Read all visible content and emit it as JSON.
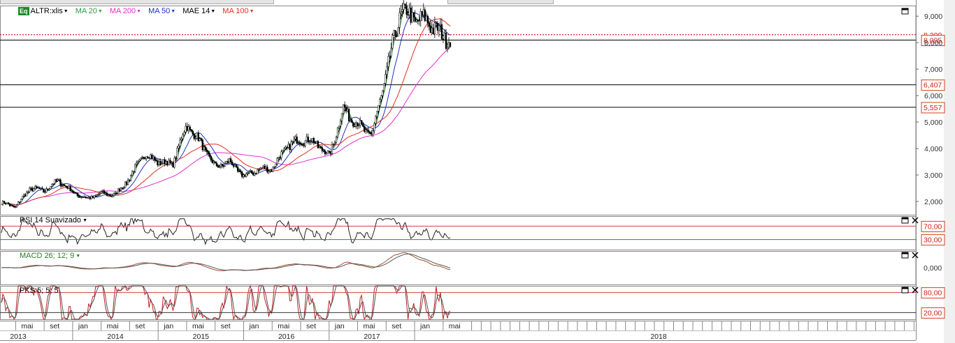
{
  "legend": {
    "eq_badge": "Eq",
    "instrument": "ALTR:xlis",
    "items": [
      {
        "label": "MA 20",
        "color": "#2aa04a"
      },
      {
        "label": "MA 200",
        "color": "#e030d0"
      },
      {
        "label": "MA 50",
        "color": "#2030c0"
      },
      {
        "label": "MAE 14",
        "color": "#000000"
      },
      {
        "label": "MA 100",
        "color": "#e03020"
      }
    ]
  },
  "panels": {
    "rsi": {
      "label": "RSI 14 Suavizado",
      "ref_levels": [
        "70,00",
        "30,00"
      ]
    },
    "macd": {
      "label": "MACD 26; 12; 9",
      "ref_levels": [
        "0,000"
      ]
    },
    "pks": {
      "label": "PKS 5; 5; 5",
      "ref_levels": [
        "80,00",
        "20,00"
      ]
    }
  },
  "chart_data": {
    "type": "candlestick",
    "title": "",
    "price_axis_ticks": [
      "2,000",
      "3,000",
      "4,000",
      "5,000",
      "6,000",
      "7,000",
      "8,000",
      "9,000"
    ],
    "price_ylim": [
      1.5,
      9.4
    ],
    "horizontal_levels": [
      {
        "value": 8.3,
        "label": "8,300",
        "style": "dotted",
        "color": "#cc2020"
      },
      {
        "value": 8.095,
        "label": "8,095"
      },
      {
        "value": 6.407,
        "label": "6,407"
      },
      {
        "value": 5.557,
        "label": "5,557"
      }
    ],
    "x_months": [
      "mai",
      "set",
      "jan",
      "mai",
      "set",
      "jan",
      "mai",
      "set",
      "jan",
      "mai",
      "set",
      "jan",
      "mai",
      "set",
      "jan",
      "mai"
    ],
    "x_years": [
      "2013",
      "2014",
      "2015",
      "2016",
      "2017",
      "2018"
    ],
    "x_start": "2013-03",
    "x_end": "2018-06",
    "price_series": {
      "name": "ALTR:xlis",
      "dates": [
        "2013-03",
        "2013-05",
        "2013-07",
        "2013-09",
        "2013-11",
        "2014-01",
        "2014-03",
        "2014-05",
        "2014-07",
        "2014-09",
        "2014-11",
        "2015-01",
        "2015-03",
        "2015-05",
        "2015-07",
        "2015-09",
        "2015-11",
        "2016-01",
        "2016-03",
        "2016-05",
        "2016-07",
        "2016-09",
        "2016-11",
        "2017-01",
        "2017-03",
        "2017-05",
        "2017-07",
        "2017-09",
        "2017-11",
        "2018-01",
        "2018-03",
        "2018-05"
      ],
      "close": [
        1.95,
        1.8,
        2.5,
        2.4,
        2.8,
        2.35,
        2.1,
        2.3,
        2.25,
        2.9,
        3.8,
        3.5,
        3.4,
        4.9,
        4.2,
        3.3,
        3.5,
        2.95,
        3.2,
        3.25,
        4.05,
        4.35,
        4.25,
        3.7,
        5.5,
        4.9,
        4.5,
        6.8,
        9.2,
        8.9,
        8.8,
        8.2
      ]
    },
    "rsi": {
      "ref_levels": [
        70,
        30
      ]
    },
    "macd": {
      "ref_levels": [
        0
      ]
    },
    "pks": {
      "ref_levels": [
        80,
        20
      ]
    }
  }
}
